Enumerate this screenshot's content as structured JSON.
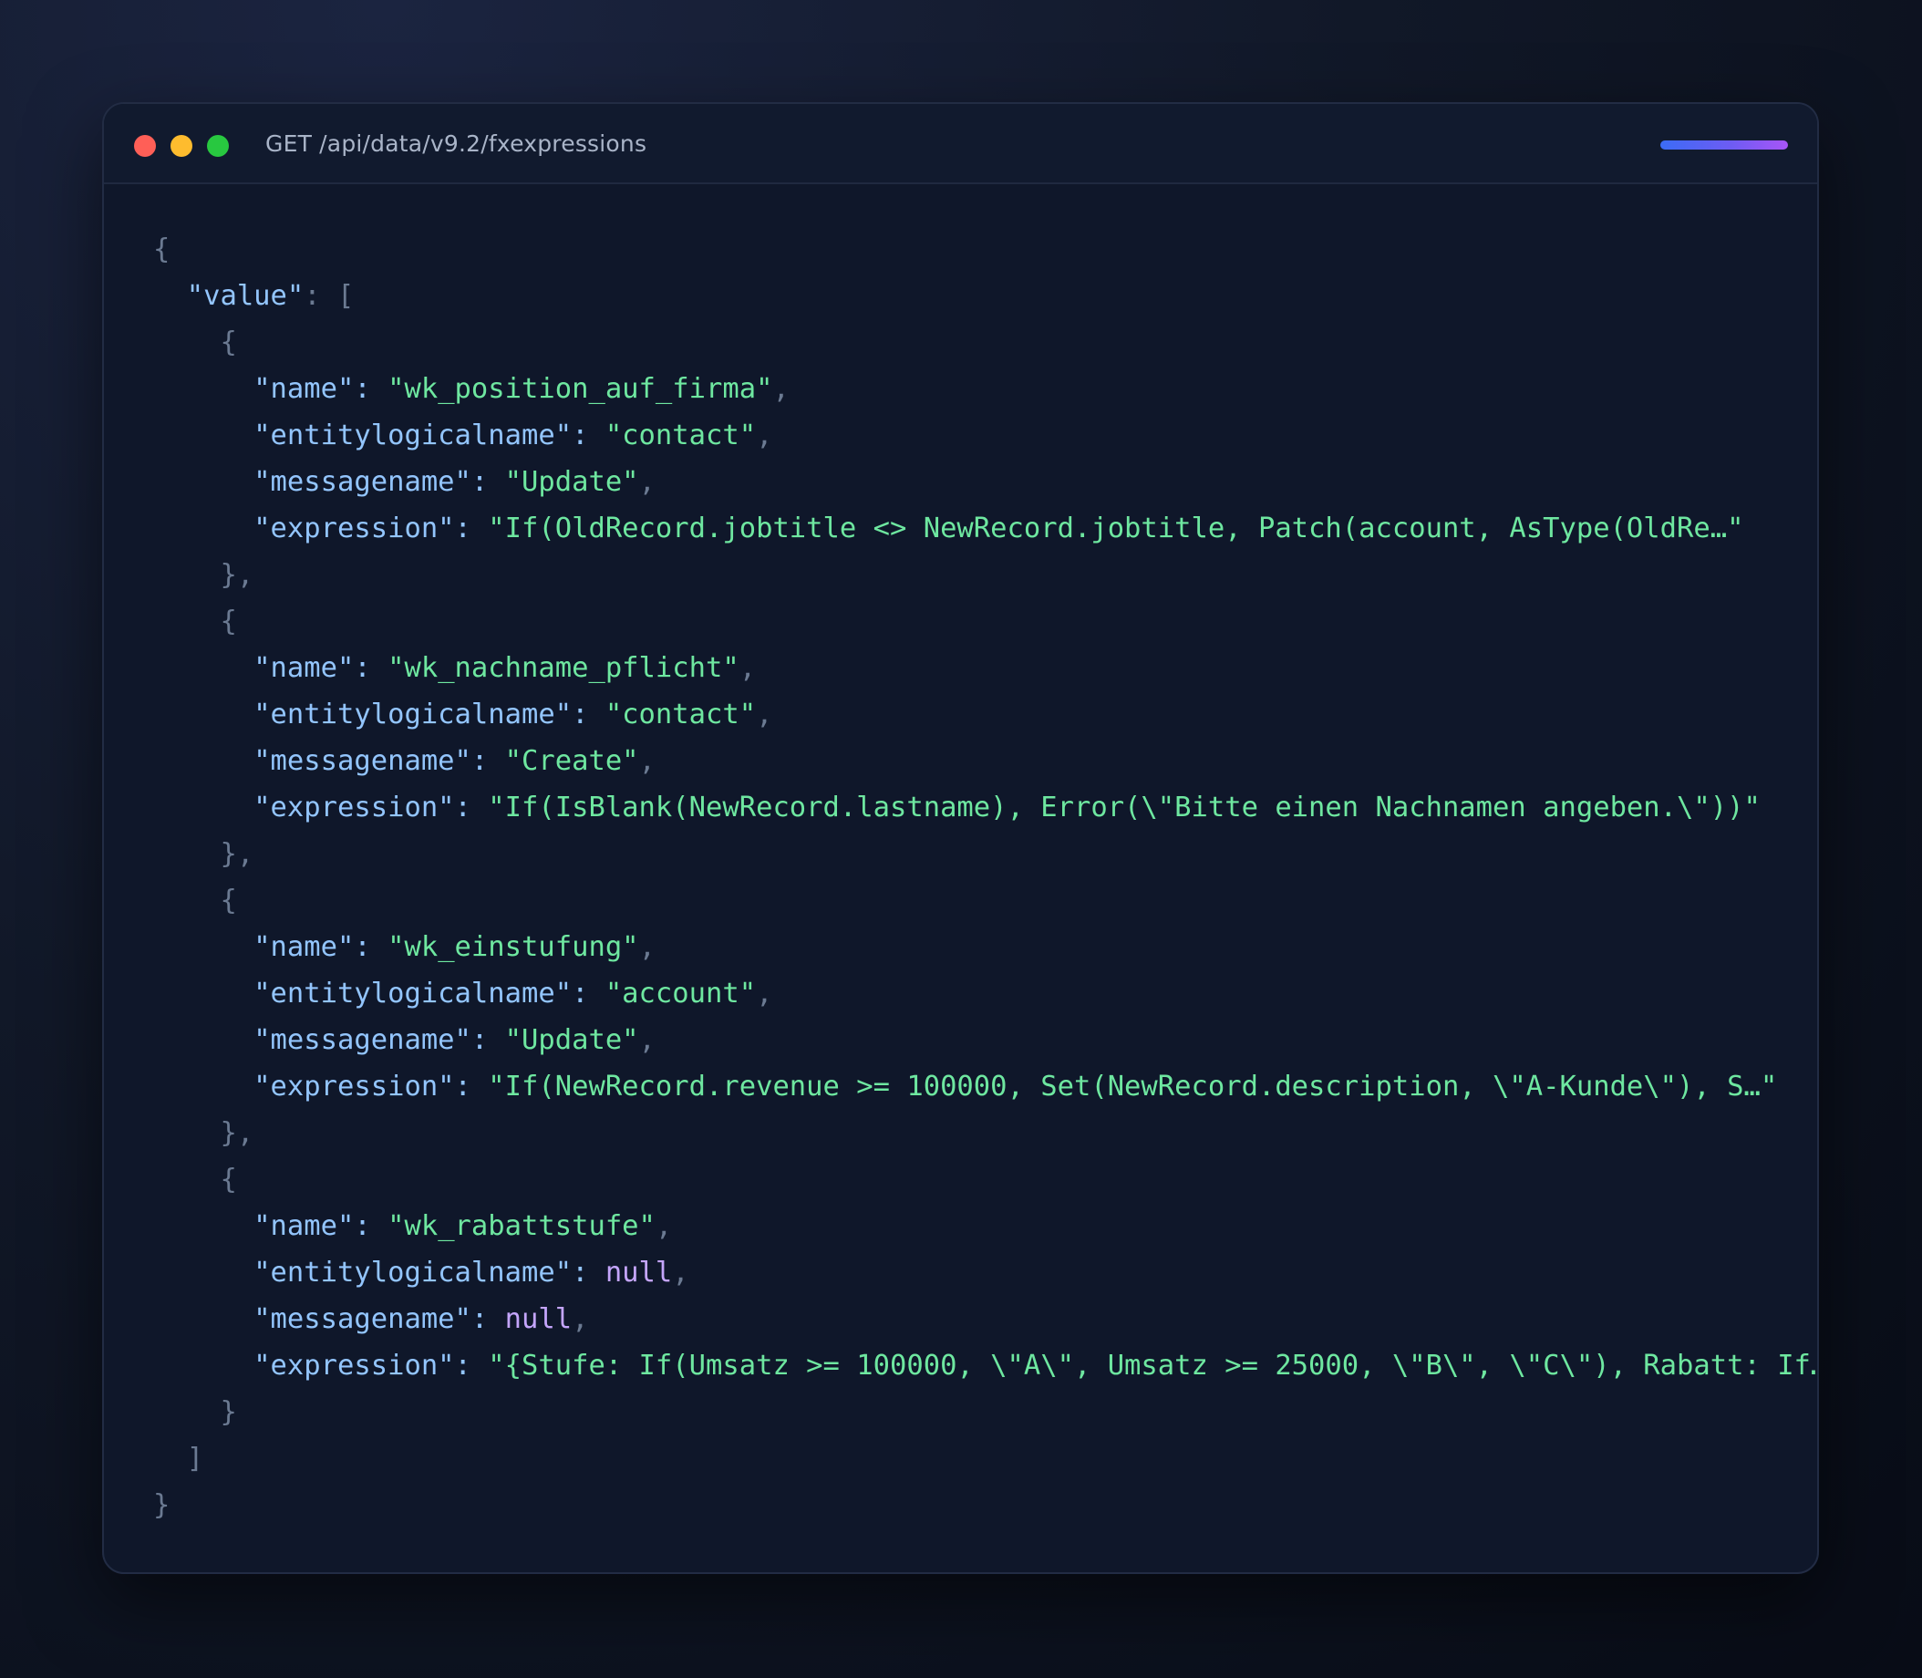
{
  "window": {
    "title": "GET /api/data/v9.2/fxexpressions",
    "controls": [
      "close",
      "minimize",
      "maximize"
    ]
  },
  "colors": {
    "background": "#0b1120",
    "panel": "#0f172a",
    "key": "#93c5fd",
    "string": "#6ee7a0",
    "null": "#c4a5fb",
    "punctuation": "#6b7a92",
    "accent_start": "#3b6cf6",
    "accent_end": "#a855f7"
  },
  "json": {
    "root_key": "value",
    "null_literal": "null",
    "records": [
      {
        "name": "wk_position_auf_firma",
        "entitylogicalname": "contact",
        "messagename": "Update",
        "expression": "If(OldRecord.jobtitle <> NewRecord.jobtitle, Patch(account, AsType(OldRe…"
      },
      {
        "name": "wk_nachname_pflicht",
        "entitylogicalname": "contact",
        "messagename": "Create",
        "expression": "If(IsBlank(NewRecord.lastname), Error(\\\"Bitte einen Nachnamen angeben.\\\"))"
      },
      {
        "name": "wk_einstufung",
        "entitylogicalname": "account",
        "messagename": "Update",
        "expression": "If(NewRecord.revenue >= 100000, Set(NewRecord.description, \\\"A-Kunde\\\"), S…"
      },
      {
        "name": "wk_rabattstufe",
        "entitylogicalname": null,
        "messagename": null,
        "expression": "{Stufe: If(Umsatz >= 100000, \\\"A\\\", Umsatz >= 25000, \\\"B\\\", \\\"C\\\"), Rabatt: If…"
      }
    ]
  }
}
